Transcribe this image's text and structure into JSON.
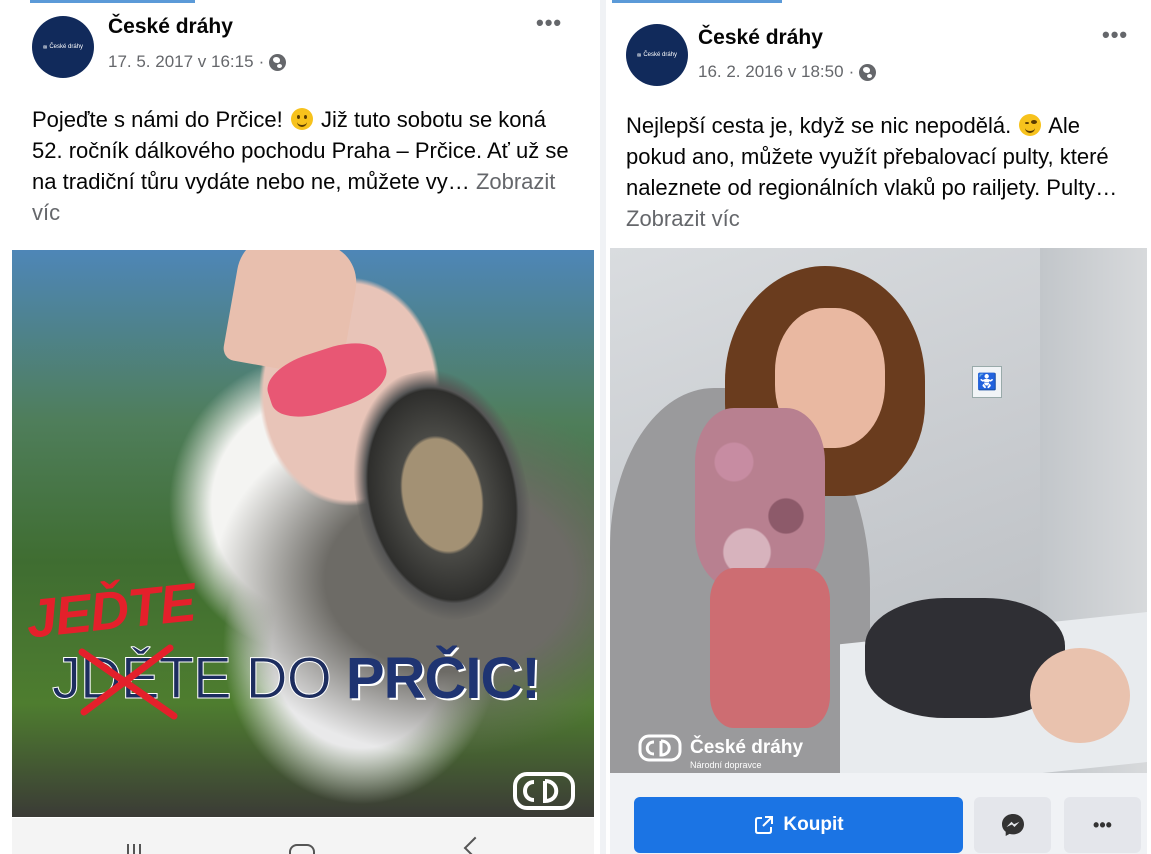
{
  "colors": {
    "brand_navy": "#112a5b",
    "facebook_blue": "#1b74e4",
    "meta_gray": "#65676b",
    "jedte_red": "#e4202b"
  },
  "left_post": {
    "page_name": "České dráhy",
    "timestamp": "17. 5. 2017 v 16:15",
    "privacy_separator": "·",
    "privacy_icon": "globe-icon",
    "more_icon": "•••",
    "avatar_logo_text": "České dráhy",
    "text_lines": {
      "part1": "Pojeďte s námi do Prčice! ",
      "part2": " Již tuto sobotu se koná 52. ročník dálkového pochodu Praha – Prčice. Ať už se na tradiční tůru vydáte nebo ne, můžete vy…",
      "see_more": "Zobrazit víc"
    },
    "image": {
      "handwritten_word": "JEĎTE",
      "headline_struck": "JDĚTE",
      "headline_middle": " DO ",
      "headline_strong": "PRČIC!"
    }
  },
  "right_post": {
    "page_name": "České dráhy",
    "timestamp": "16. 2. 2016 v 18:50",
    "privacy_separator": "·",
    "privacy_icon": "globe-icon",
    "more_icon": "•••",
    "avatar_logo_text": "České dráhy",
    "text_lines": {
      "part1": "Nejlepší cesta je, když se nic nepodělá. ",
      "part2": " Ale pokud ano, můžete využít přebalovací pulty, které naleznete od regionálních vlaků po railjety. Pulty…",
      "see_more": "Zobrazit víc"
    },
    "image": {
      "brand_name": "České dráhy",
      "brand_tagline": "Národní dopravce",
      "sign_symbol": "🚼"
    },
    "cta": {
      "buy_label": "Koupit",
      "more_label": "•••"
    }
  }
}
